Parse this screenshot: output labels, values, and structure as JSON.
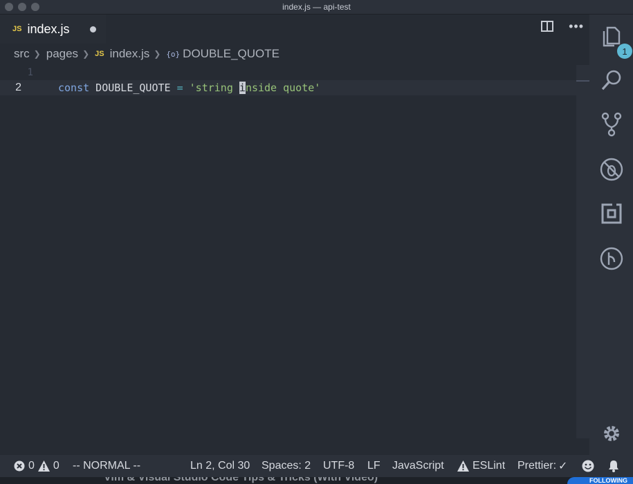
{
  "window": {
    "title": "index.js — api-test"
  },
  "tab": {
    "badge": "JS",
    "label": "index.js",
    "more": "•••"
  },
  "breadcrumb": {
    "items": [
      "src",
      "pages"
    ],
    "file_badge": "JS",
    "file": "index.js",
    "symbol_icon": "{o}",
    "symbol": "DOUBLE_QUOTE"
  },
  "editor": {
    "lines": [
      {
        "number": "1",
        "text": ""
      },
      {
        "number": "2",
        "kw": "const",
        "ident": " DOUBLE_QUOTE ",
        "op": "=",
        "str_pre": " 'string ",
        "cursor_char": "i",
        "str_post": "nside quote'"
      }
    ]
  },
  "activity": {
    "badge_count": "1"
  },
  "status": {
    "errors": "0",
    "warnings": "0",
    "mode": "-- NORMAL --",
    "position": "Ln 2, Col 30",
    "spaces": "Spaces: 2",
    "encoding": "UTF-8",
    "eol": "LF",
    "language": "JavaScript",
    "eslint": "ESLint",
    "prettier": "Prettier:",
    "prettier_check": "✓"
  },
  "overlay": {
    "caption": "Vim & Visual Studio Code Tips & Tricks (With Video)",
    "follow": "FOLLOWING"
  },
  "colors": {
    "background": "#262b33",
    "accent": "#5fb9d4",
    "string": "#98c379",
    "keyword": "#80a6e0"
  }
}
